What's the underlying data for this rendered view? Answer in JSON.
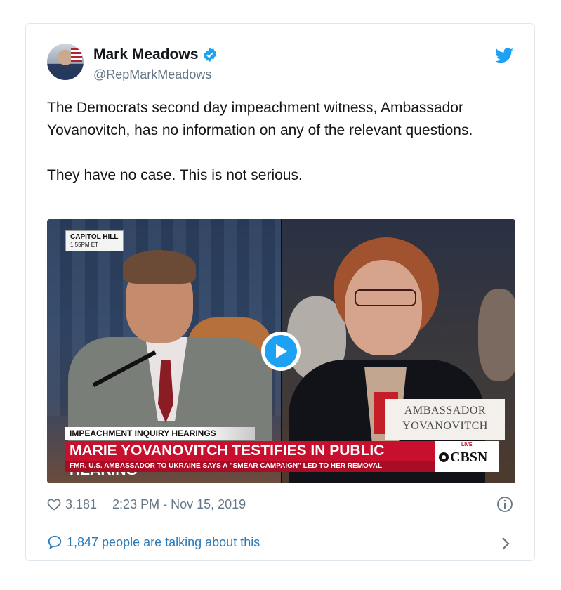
{
  "tweet": {
    "author_name": "Mark Meadows",
    "author_handle": "@RepMarkMeadows",
    "text": "The Democrats second day impeachment witness, Ambassador Yovanovitch, has no information on any of the relevant questions.\n\nThey have no case. This is not serious.",
    "likes": "3,181",
    "timestamp": "2:23 PM - Nov 15, 2019",
    "talking_about": "1,847 people are talking about this"
  },
  "video": {
    "location_tag": "CAPITOL HILL",
    "time_tag": "1:55PM ET",
    "nameplate_line1": "AMBASSADOR",
    "nameplate_line2": "YOVANOVITCH",
    "banner_top": "IMPEACHMENT INQUIRY HEARINGS",
    "banner_main": "MARIE YOVANOVITCH TESTIFIES IN PUBLIC HEARING",
    "banner_sub": "FMR. U.S. AMBASSADOR TO UKRAINE SAYS A \"SMEAR CAMPAIGN\" LED TO HER REMOVAL",
    "network_live": "LIVE",
    "network_logo": "CBSN"
  },
  "icons": {
    "verified": "verified-badge-icon",
    "bird": "twitter-bird-icon",
    "play": "play-icon",
    "heart": "heart-icon",
    "info": "info-icon",
    "bubble": "speech-bubble-icon",
    "chevron": "chevron-right-icon"
  },
  "colors": {
    "twitter_blue": "#1da1f2",
    "link_blue": "#2b7bb9",
    "secondary_text": "#657786",
    "banner_red": "#c8102e"
  }
}
